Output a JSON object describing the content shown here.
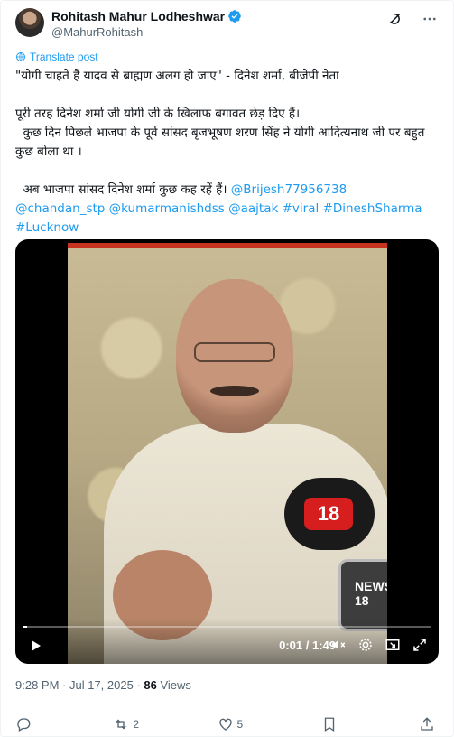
{
  "author": {
    "display_name": "Rohitash Mahur Lodheshwar",
    "handle": "@MahurRohitash",
    "verified": true
  },
  "translate_label": "Translate post",
  "tweet": {
    "line1": "\"योगी चाहते हैं यादव से ब्राह्मण अलग हो जाए\" - दिनेश शर्मा, बीजेपी नेता",
    "line2": "पूरी तरह दिनेश शर्मा जी योगी जी के खिलाफ बगावत छेड़ दिए हैं।",
    "line3": "  कुछ दिन पिछले भाजपा के पूर्व सांसद बृजभूषण शरण सिंह ने योगी आदित्यनाथ जी पर बहुत कुछ बोला था ।",
    "line4": "  अब भाजपा सांसद दिनेश शर्मा कुछ कह रहें हैं।",
    "mentions": [
      "@Brijesh77956738",
      "@chandan_stp",
      "@kumarmanishdss",
      "@aajtak"
    ],
    "hashtags": [
      "#viral",
      "#DineshSharma",
      "#Lucknow"
    ]
  },
  "video": {
    "time_label": "0:01 / 1:49",
    "progress": 0.01,
    "overlay_logo": "18",
    "mic_label": "NEWS 18"
  },
  "meta": {
    "time": "9:28 PM",
    "separator": " · ",
    "date": "Jul 17, 2025",
    "views_count": "86",
    "views_label": "Views"
  },
  "actions": {
    "replies": "",
    "reposts": "2",
    "likes": "5",
    "bookmarks": "",
    "share": ""
  },
  "colors": {
    "link": "#1d9bf0",
    "text": "#0f1419",
    "muted": "#536471"
  }
}
